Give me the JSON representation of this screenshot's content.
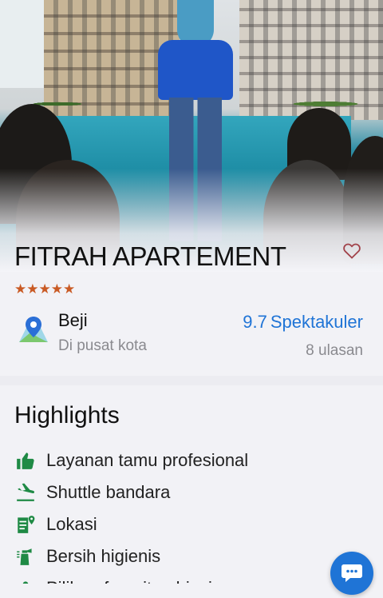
{
  "property": {
    "name": "FITRAH APARTEMENT",
    "rating_stars": "★★★★★",
    "favorite_icon": "heart-outline-icon"
  },
  "location": {
    "area": "Beji",
    "description": "Di pusat kota",
    "icon": "map-pin-icon"
  },
  "review": {
    "score": "9.7",
    "label": "Spektakuler",
    "count_text": "8 ulasan",
    "accent_color": "#1f74d6"
  },
  "highlights": {
    "title": "Highlights",
    "items": [
      {
        "label": "Layanan tamu profesional",
        "icon": "thumbs-up-icon"
      },
      {
        "label": "Shuttle bandara",
        "icon": "plane-landing-icon"
      },
      {
        "label": "Lokasi",
        "icon": "location-document-icon"
      },
      {
        "label": "Bersih higienis",
        "icon": "cleaning-spray-icon"
      },
      {
        "label": "Pilihan favorit pebisnis",
        "icon": "briefcase-icon"
      }
    ],
    "icon_color": "#1f8a45"
  },
  "chat": {
    "icon": "chat-bubble-icon"
  },
  "colors": {
    "star": "#c95a24",
    "heart": "#a1424a",
    "muted_text": "#8a8a8f"
  }
}
